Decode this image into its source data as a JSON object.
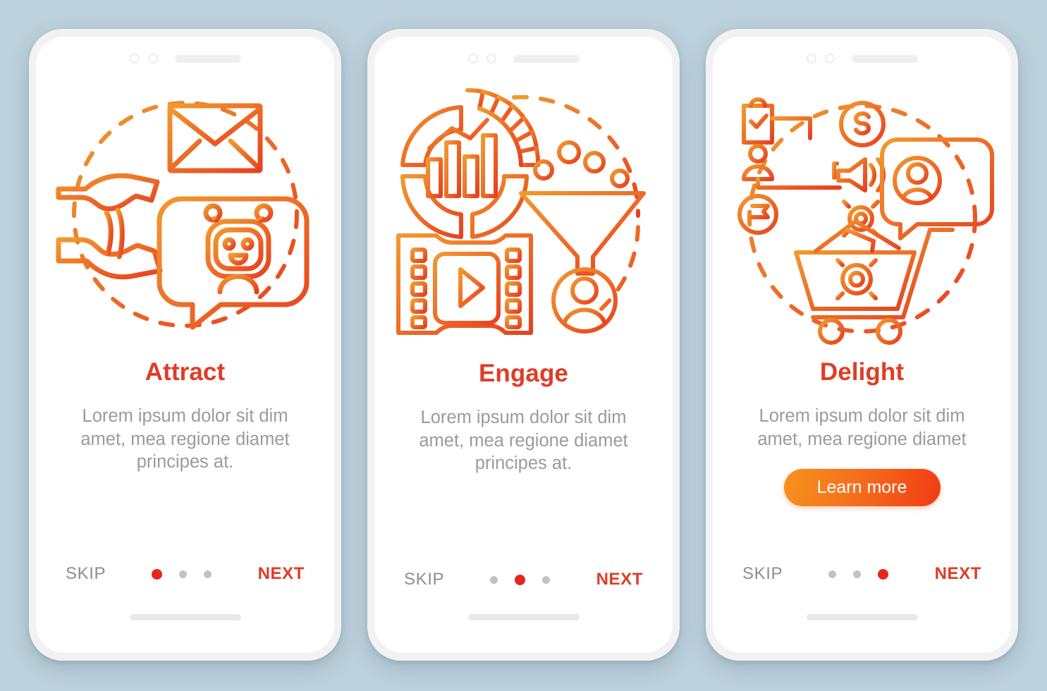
{
  "page": {
    "background_color": "#bcd1dc",
    "accent_color": "#e03c26",
    "muted_text_color": "#9b9b9b",
    "cta_gradient_from": "#f6921e",
    "cta_gradient_to": "#f23b14"
  },
  "screens": [
    {
      "id": "attract",
      "illustration_name": "email-chatbot-magnet-illustration",
      "title": "Attract",
      "description": "Lorem ipsum dolor sit dim amet, mea regione diamet principes at.",
      "cta": null,
      "skip_label": "SKIP",
      "next_label": "NEXT",
      "dots": {
        "count": 3,
        "active_index": 0
      }
    },
    {
      "id": "engage",
      "illustration_name": "analytics-funnel-video-illustration",
      "title": "Engage",
      "description": "Lorem ipsum dolor sit dim amet, mea regione diamet principes at.",
      "cta": null,
      "skip_label": "SKIP",
      "next_label": "NEXT",
      "dots": {
        "count": 3,
        "active_index": 1
      }
    },
    {
      "id": "delight",
      "illustration_name": "cart-chat-workflow-illustration",
      "title": "Delight",
      "description": "Lorem ipsum dolor sit dim amet, mea regione diamet",
      "cta": "Learn more",
      "skip_label": "SKIP",
      "next_label": "NEXT",
      "dots": {
        "count": 3,
        "active_index": 2
      }
    }
  ]
}
